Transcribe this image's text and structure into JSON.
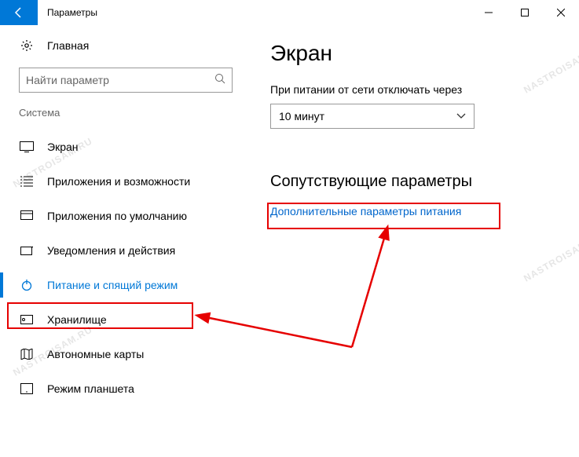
{
  "window": {
    "title": "Параметры"
  },
  "sidebar": {
    "home": "Главная",
    "search_placeholder": "Найти параметр",
    "category": "Система",
    "items": [
      {
        "label": "Экран"
      },
      {
        "label": "Приложения и возможности"
      },
      {
        "label": "Приложения по умолчанию"
      },
      {
        "label": "Уведомления и действия"
      },
      {
        "label": "Питание и спящий режим"
      },
      {
        "label": "Хранилище"
      },
      {
        "label": "Автономные карты"
      },
      {
        "label": "Режим планшета"
      }
    ]
  },
  "main": {
    "heading": "Экран",
    "setting_label": "При питании от сети отключать через",
    "dropdown_value": "10 минут",
    "related_heading": "Сопутствующие параметры",
    "link": "Дополнительные параметры питания"
  },
  "watermark": "NASTROISAM.RU"
}
